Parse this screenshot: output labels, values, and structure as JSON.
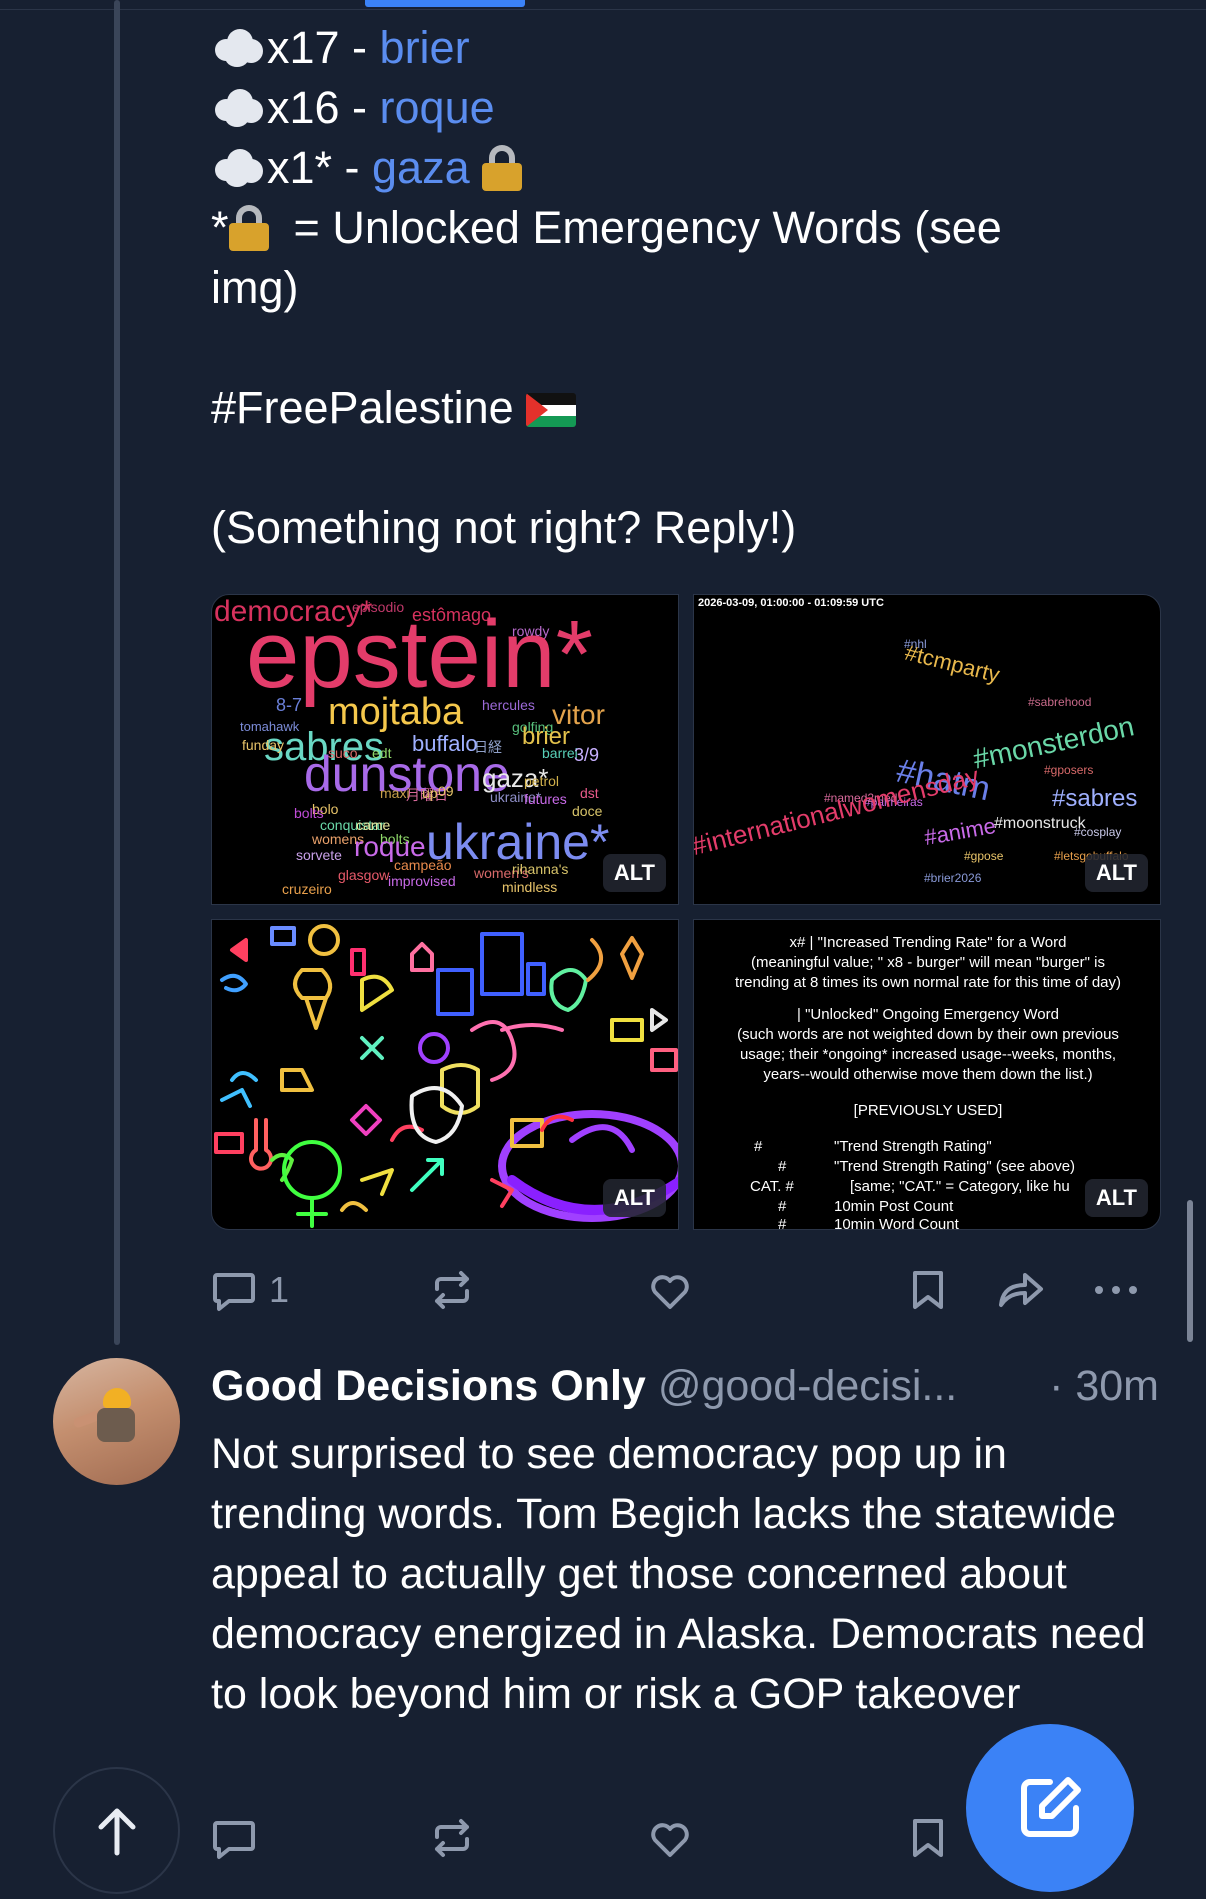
{
  "colors": {
    "background": "#172031",
    "link": "#5b8def",
    "muted": "#8e99ad",
    "accent": "#3b82f6"
  },
  "post": {
    "lines": [
      {
        "prefix": "x17 - ",
        "word": "brier"
      },
      {
        "prefix": "x16 - ",
        "word": "roque"
      },
      {
        "prefix": "x1* - ",
        "word": "gaza"
      }
    ],
    "legend_star": "*",
    "legend_text": " = Unlocked Emergency Words (see",
    "legend_text2": "img)",
    "hashtag": "#FreePalestine",
    "footer": "(Something not right? Reply!)",
    "images": {
      "alt_label": "ALT",
      "wordcloud1": {
        "words": [
          "epstein*",
          "democracy*",
          "estômago",
          "episodio",
          "rowdy",
          "mojtaba",
          "sabres",
          "buffalo",
          "brier",
          "vitor",
          "dunstone",
          "gaza*",
          "3/9",
          "hercules",
          "golfing",
          "barrel",
          "tomahawk",
          "ukraine*",
          "roque",
          "futures",
          "funday",
          "campeão",
          "improvised",
          "glasgow",
          "cruzeiro",
          "women's",
          "conquistar",
          "bolts",
          "doce",
          "womens",
          "sorvete",
          "rihanna's",
          "mindless",
          "petrol",
          "edt",
          "suco",
          "bolo",
          "came",
          "09",
          "up",
          "maxi",
          "月曜日",
          "日経",
          "dst",
          "8-7"
        ]
      },
      "wordcloud2": {
        "header": "2026-03-09, 01:00:00 - 01:09:59 UTC",
        "words": [
          "#tcmparty",
          "#monsterdon",
          "#hatm",
          "#sabres",
          "#internationalwomensday",
          "#anime",
          "#moonstruck",
          "#gposers",
          "#nhl",
          "#sabrehood",
          "#palmeiras",
          "#gpose",
          "#letsgobuffalo",
          "#brier2026",
          "#cosplay",
          "#named2med"
        ]
      },
      "legend": {
        "l1": "x#  |   \"Increased Trending Rate\" for a Word",
        "l2": "(meaningful value; \"  x8 - burger\" will mean \"burger\" is",
        "l3": "trending at 8 times its own normal rate for this time of day)",
        "l4": "|   \"Unlocked\" Ongoing Emergency Word",
        "l5": "(such words are not weighted down by their own previous",
        "l6": "usage; their *ongoing* increased usage--weeks, months,",
        "l7": "years--would otherwise move them down the list.)",
        "l8": "[PREVIOUSLY USED]",
        "r1a": "#",
        "r1b": "\"Trend Strength Rating\"",
        "r2a": "#",
        "r2b": "\"Trend Strength Rating\" (see above)",
        "r3a": "CAT. #",
        "r3b": "[same; \"CAT.\" = Category, like hu",
        "r4a": "#",
        "r4b": "10min Post Count",
        "r5a": "#",
        "r5b": "10min Word Count"
      }
    },
    "reply_count": "1"
  },
  "reply": {
    "author": "Good Decisions Only",
    "handle": "@good-decisi...",
    "time": "· 30m",
    "text": "Not surprised to see democracy pop up in trending words. Tom Begich lacks the statewide appeal to actually get those concerned about democracy energized in Alaska. Democrats need to look beyond him or risk a GOP takeover"
  },
  "icons": {
    "reply": "reply-icon",
    "repost": "repost-icon",
    "like": "heart-icon",
    "bookmark": "bookmark-icon",
    "share": "share-icon",
    "more": "more-icon",
    "scroll_top": "arrow-up-icon",
    "compose": "compose-icon"
  }
}
